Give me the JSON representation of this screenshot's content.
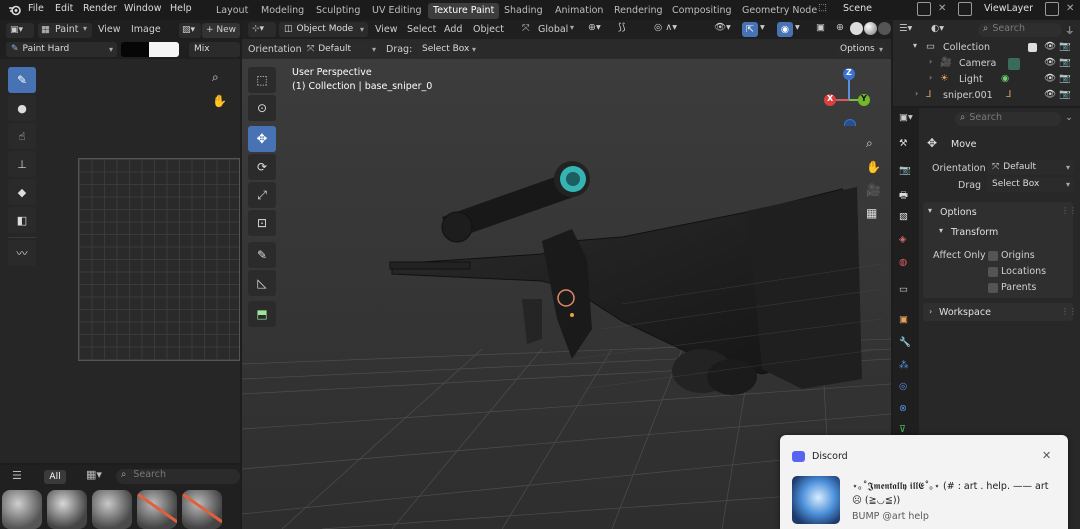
{
  "menus": [
    "File",
    "Edit",
    "Render",
    "Window",
    "Help"
  ],
  "workspaces": [
    "Layout",
    "Modeling",
    "Sculpting",
    "UV Editing",
    "Texture Paint",
    "Shading",
    "Animation",
    "Rendering",
    "Compositing",
    "Geometry Node"
  ],
  "scene": "Scene",
  "viewlayer": "ViewLayer",
  "left_header": {
    "mode": "Paint",
    "view": "View",
    "image": "Image",
    "new": "New"
  },
  "brush": {
    "name": "Paint Hard",
    "blend": "Mix"
  },
  "asset_bar": {
    "all": "All",
    "search_placeholder": "Search"
  },
  "viewport_header": {
    "mode": "Object Mode",
    "view": "View",
    "select": "Select",
    "add": "Add",
    "object": "Object",
    "transform": "Global"
  },
  "tool_header": {
    "orientation_label": "Orientation:",
    "orientation": "Default",
    "drag_label": "Drag:",
    "drag": "Select Box",
    "options": "Options"
  },
  "viewport": {
    "title": "User Perspective",
    "subtitle": "(1) Collection | base_sniper_0"
  },
  "gizmo": {
    "x": "X",
    "y": "Y",
    "z": "Z"
  },
  "outliner": {
    "search_placeholder": "Search",
    "items": [
      "Collection",
      "Camera",
      "Light",
      "sniper.001"
    ]
  },
  "properties": {
    "search_placeholder": "Search",
    "tool": "Move",
    "orientation_label": "Orientation",
    "orientation": "Default",
    "drag_label": "Drag",
    "drag": "Select Box",
    "options": "Options",
    "transform": "Transform",
    "affect_only": "Affect Only",
    "affect": [
      "Origins",
      "Locations",
      "Parents"
    ],
    "workspace": "Workspace"
  },
  "notification": {
    "app": "Discord",
    "message": "⋆｡˚𝕵𝖒𝖊𝖓𝖙𝖆𝖑𝖑𝖞 𝖎𝖑𝖑𝕰˚｡⋆ (# : art . help. —— art ☹ (≧◡≦))",
    "footer": "BUMP @art help"
  }
}
